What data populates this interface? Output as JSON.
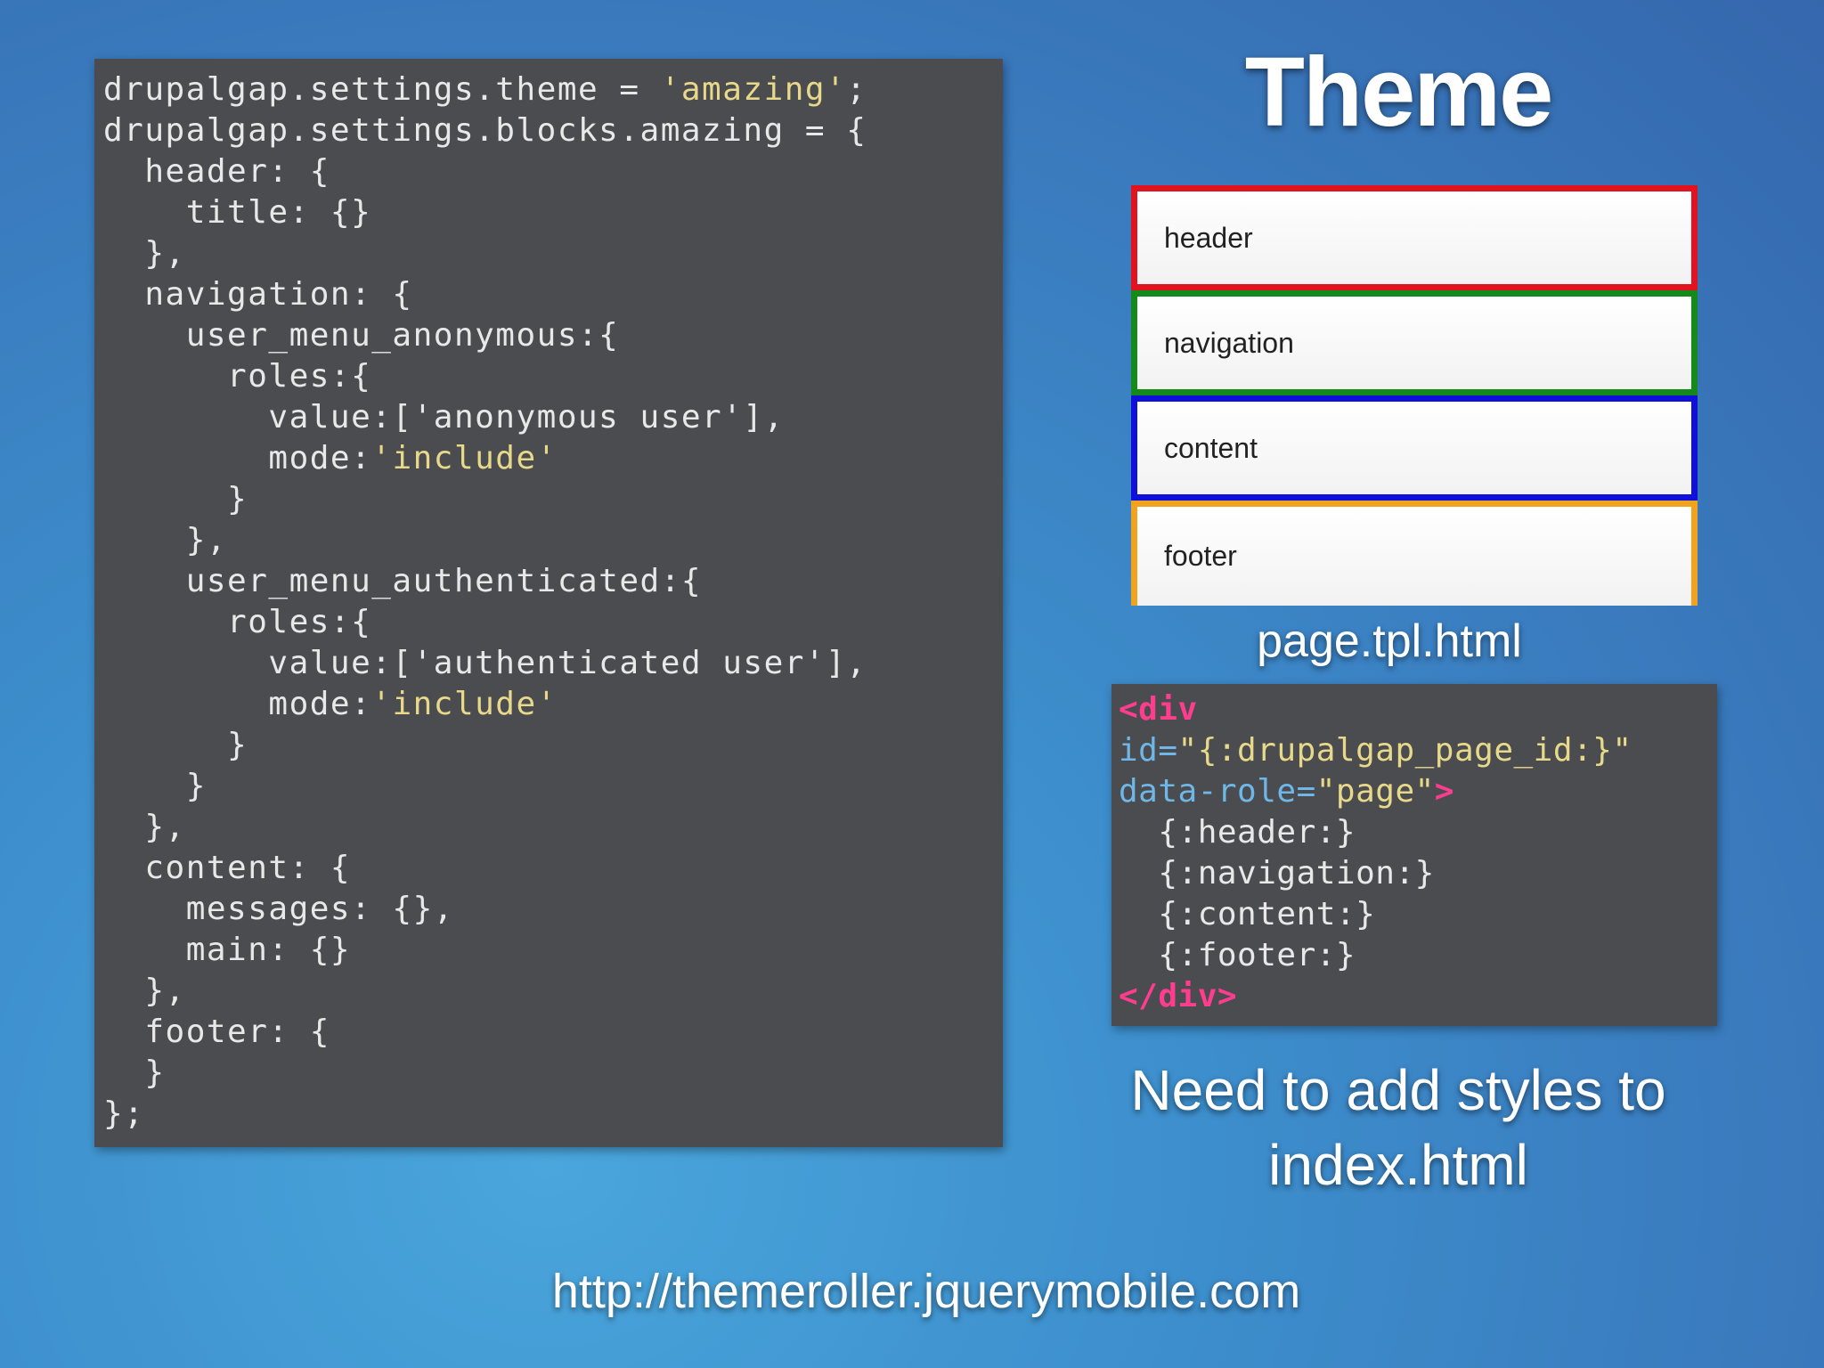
{
  "slide": {
    "title": "Theme",
    "page_template_label": "page.tpl.html",
    "note_line1": "Need to add styles to",
    "note_line2": "index.html",
    "url": "http://themeroller.jquerymobile.com"
  },
  "regions": [
    {
      "label": "header",
      "border_color": "#e3121f"
    },
    {
      "label": "navigation",
      "border_color": "#138a19"
    },
    {
      "label": "content",
      "border_color": "#1010dd"
    },
    {
      "label": "footer",
      "border_color": "#f2a31e"
    }
  ],
  "settings_code": {
    "l01a": "drupalgap.settings.theme = ",
    "l01b": "'amazing'",
    "l01c": ";",
    "l02": "drupalgap.settings.blocks.amazing = {",
    "l03": "  header: {",
    "l04": "    title: {}",
    "l05": "  },",
    "l06": "  navigation: {",
    "l07": "    user_menu_anonymous:{",
    "l08": "      roles:{",
    "l09": "        value:['anonymous user'],",
    "l10a": "        mode:",
    "l10b": "'include'",
    "l11": "      }",
    "l12": "    },",
    "l13": "    user_menu_authenticated:{",
    "l14": "      roles:{",
    "l15": "        value:['authenticated user'],",
    "l16a": "        mode:",
    "l16b": "'include'",
    "l17": "      }",
    "l18": "    }",
    "l19": "  },",
    "l20": "  content: {",
    "l21": "    messages: {},",
    "l22": "    main: {}",
    "l23": "  },",
    "l24": "  footer: {",
    "l25": "  }",
    "l26": "};"
  },
  "template_code": {
    "open_tag": "<div",
    "id_attr": "id=",
    "id_value": "\"{:drupalgap_page_id:}\"",
    "role_attr": "data-role=",
    "role_value": "\"page\"",
    "open_tag_end": ">",
    "header_token": "  {:header:}",
    "navigation_token": "  {:navigation:}",
    "content_token": "  {:content:}",
    "footer_token": "  {:footer:}",
    "close_tag": "</div>"
  },
  "colors": {
    "code_background": "#4b4c50",
    "code_text": "#e8e8e8",
    "string_literal": "#e8d98a",
    "html_tag": "#ff3d8e",
    "html_attr": "#6fb7e6"
  }
}
